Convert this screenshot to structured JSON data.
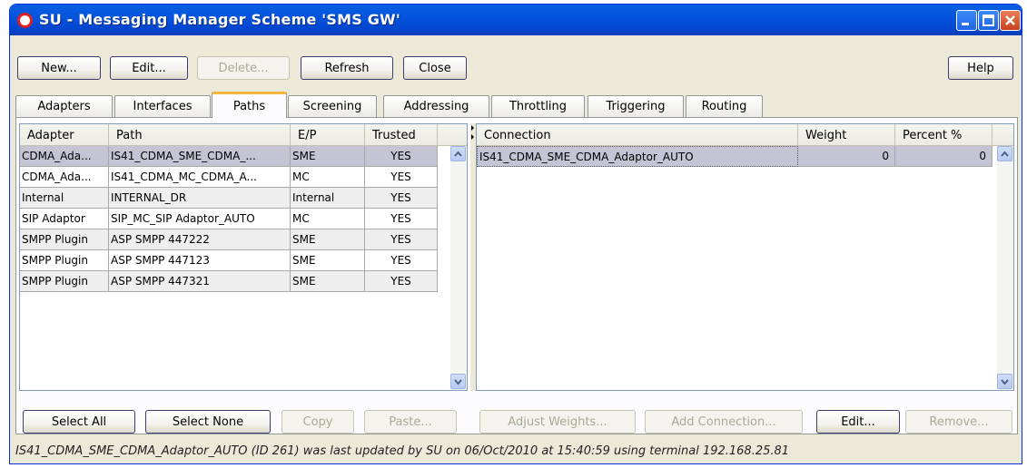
{
  "window": {
    "title": "SU - Messaging Manager Scheme 'SMS GW'"
  },
  "toolbar": {
    "new_label": "New...",
    "edit_label": "Edit...",
    "delete_label": "Delete...",
    "refresh_label": "Refresh",
    "close_label": "Close",
    "help_label": "Help"
  },
  "tabs": [
    "Adapters",
    "Interfaces",
    "Paths",
    "Screening",
    "Addressing",
    "Throttling",
    "Triggering",
    "Routing"
  ],
  "active_tab": "Paths",
  "paths_table": {
    "columns": [
      "Adapter",
      "Path",
      "E/P",
      "Trusted"
    ],
    "rows": [
      [
        "CDMA_Ada...",
        "IS41_CDMA_SME_CDMA_...",
        "SME",
        "YES"
      ],
      [
        "CDMA_Ada...",
        "IS41_CDMA_MC_CDMA_A...",
        "MC",
        "YES"
      ],
      [
        "Internal",
        "INTERNAL_DR",
        "Internal",
        "YES"
      ],
      [
        "SIP Adaptor",
        "SIP_MC_SIP Adaptor_AUTO",
        "MC",
        "YES"
      ],
      [
        "SMPP Plugin",
        "ASP SMPP 447222",
        "SME",
        "YES"
      ],
      [
        "SMPP Plugin",
        "ASP SMPP 447123",
        "SME",
        "YES"
      ],
      [
        "SMPP Plugin",
        "ASP SMPP 447321",
        "SME",
        "YES"
      ]
    ]
  },
  "connections_table": {
    "columns": [
      "Connection",
      "Weight",
      "Percent %"
    ],
    "rows": [
      [
        "IS41_CDMA_SME_CDMA_Adaptor_AUTO",
        "0",
        "0"
      ]
    ]
  },
  "left_buttons": {
    "select_all": "Select All",
    "select_none": "Select None",
    "copy": "Copy",
    "paste": "Paste..."
  },
  "right_buttons": {
    "adjust_weights": "Adjust Weights...",
    "add_connection": "Add Connection...",
    "edit": "Edit...",
    "remove": "Remove..."
  },
  "status": "IS41_CDMA_SME_CDMA_Adaptor_AUTO (ID 261) was last updated by SU on 06/Oct/2010 at 15:40:59 using terminal 192.168.25.81",
  "colors": {
    "titlebar": "#0454de",
    "selected_row": "#c4c4d4",
    "active_tab_accent": "#f4b63c"
  }
}
